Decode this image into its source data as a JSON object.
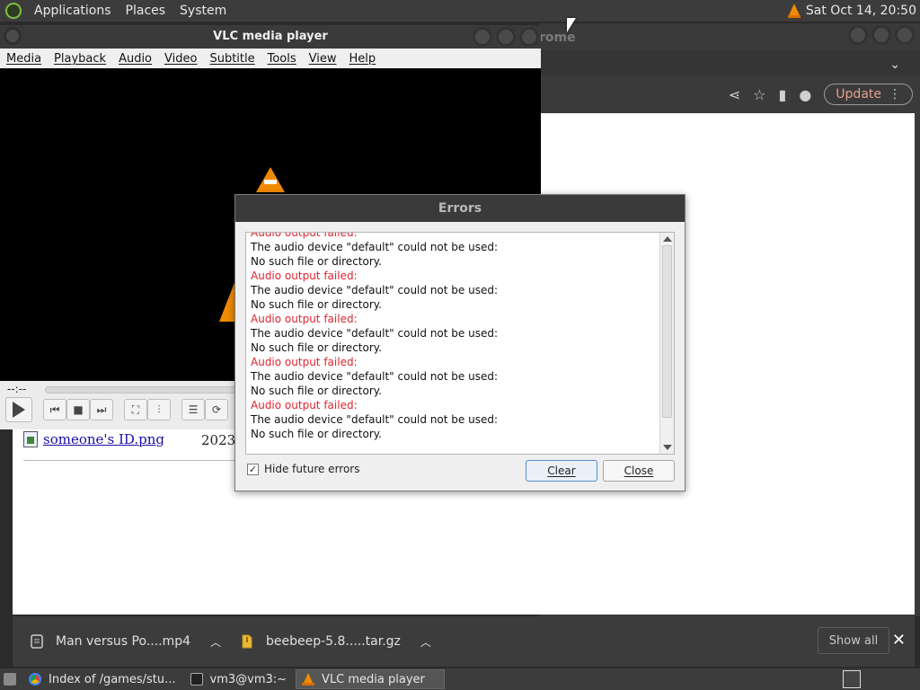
{
  "top_panel": {
    "menus": [
      "Applications",
      "Places",
      "System"
    ],
    "clock": "Sat Oct 14, 20:50"
  },
  "chrome": {
    "title_fragment": "rome",
    "update_label": "Update"
  },
  "page": {
    "file_link": "someone's ID.png",
    "file_date": "2023-"
  },
  "vlc": {
    "title": "VLC media player",
    "menus": [
      "Media",
      "Playback",
      "Audio",
      "Video",
      "Subtitle",
      "Tools",
      "View",
      "Help"
    ],
    "time_label": "--:--"
  },
  "errors_dialog": {
    "title": "Errors",
    "log": [
      {
        "text": "Audio output failed:",
        "type": "error"
      },
      {
        "text": "The audio device \"default\" could not be used:",
        "type": "info"
      },
      {
        "text": "No such file or directory.",
        "type": "info"
      },
      {
        "text": "Audio output failed:",
        "type": "error"
      },
      {
        "text": "The audio device \"default\" could not be used:",
        "type": "info"
      },
      {
        "text": "No such file or directory.",
        "type": "info"
      },
      {
        "text": "Audio output failed:",
        "type": "error"
      },
      {
        "text": "The audio device \"default\" could not be used:",
        "type": "info"
      },
      {
        "text": "No such file or directory.",
        "type": "info"
      },
      {
        "text": "Audio output failed:",
        "type": "error"
      },
      {
        "text": "The audio device \"default\" could not be used:",
        "type": "info"
      },
      {
        "text": "No such file or directory.",
        "type": "info"
      },
      {
        "text": "Audio output failed:",
        "type": "error"
      },
      {
        "text": "The audio device \"default\" could not be used:",
        "type": "info"
      },
      {
        "text": "No such file or directory.",
        "type": "info"
      }
    ],
    "hide_future_errors_label": "Hide future errors",
    "hide_future_errors_checked": true,
    "clear_label": "Clear",
    "close_label": "Close",
    "error_color": "#e0242f"
  },
  "downloads": {
    "items": [
      {
        "name": "Man versus Po....mp4",
        "icon": "video-file-icon"
      },
      {
        "name": "beebeep-5.8.....tar.gz",
        "icon": "archive-file-icon"
      }
    ],
    "show_all_label": "Show all"
  },
  "taskbar": {
    "tasks": [
      {
        "label": "Index of /games/stu...",
        "icon": "chrome-icon",
        "active": false
      },
      {
        "label": "vm3@vm3:~",
        "icon": "terminal-icon",
        "active": false
      },
      {
        "label": "VLC media player",
        "icon": "vlc-icon",
        "active": true
      }
    ]
  }
}
